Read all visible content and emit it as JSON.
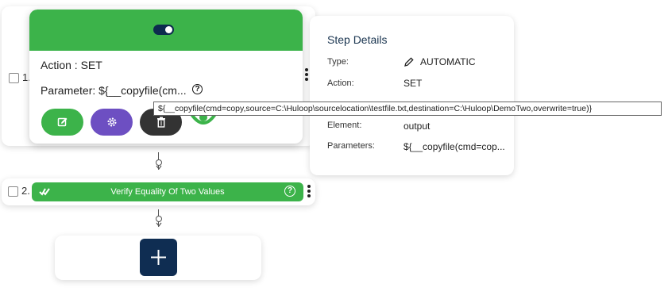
{
  "step1": {
    "number": "1.",
    "action_text": "Action : SET",
    "parameter_text": "Parameter: ${__copyfile(cm..."
  },
  "step2": {
    "number": "2.",
    "label": "Verify Equality Of Two Values"
  },
  "details": {
    "title": "Step Details",
    "rows": [
      {
        "label": "Type:",
        "value": "AUTOMATIC"
      },
      {
        "label": "Action:",
        "value": "SET"
      },
      {
        "label": "Element:",
        "value": "output"
      },
      {
        "label": "Parameters:",
        "value": "${__copyfile(cmd=cop..."
      }
    ]
  },
  "tooltip": {
    "text": "${__copyfile(cmd=copy,source=C:\\Huloop\\sourcelocation\\testfile.txt,destination=C:\\Huloop\\DemoTwo,overwrite=true)}"
  },
  "help_icon_glyph": "?",
  "colors": {
    "green": "#3cb34a",
    "purple": "#6d4fc2",
    "dark": "#333333",
    "navy": "#0f2d52"
  },
  "icons": [
    "toggle-icon",
    "help-icon",
    "edit-icon",
    "settings-icon",
    "delete-icon",
    "eye-icon",
    "pencil-icon",
    "double-check-icon",
    "plus-icon",
    "kebab-menu-icon"
  ]
}
